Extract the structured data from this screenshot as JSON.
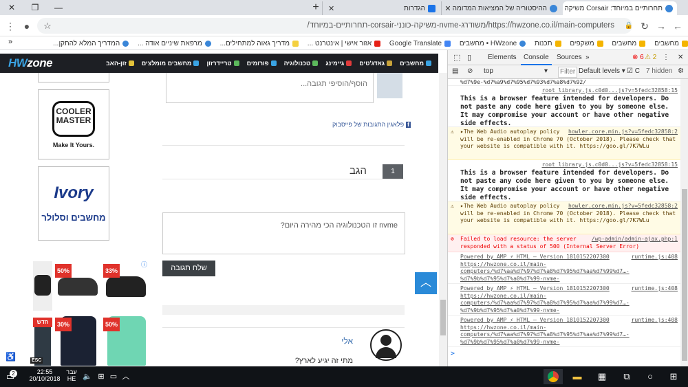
{
  "window": {
    "tabs": [
      {
        "title": "תחרותיים במיוחד: Corsair משיקה ...",
        "active": true
      },
      {
        "title": "ההיסטוריה של המציאות המדומה",
        "active": false
      },
      {
        "title": "הגדרות",
        "active": false
      }
    ],
    "new_tab": "+",
    "controls": {
      "minimize": "—",
      "maximize": "❐",
      "close": "✕"
    }
  },
  "omnibox": {
    "url": "https://hwzone.co.il/main-computers/משודרג-nvme-משיקה-כונני-corsair-תחרותיים-במיוחד/"
  },
  "bookmarks": [
    "מחשבים",
    "מחשבים",
    "משקפים",
    "תכנות",
    "HWzone • מחשבים",
    "Google Translate",
    "אזור אישי | אינטרנט ...",
    "מדריך גאוה למתחילים...",
    "מרפאת שיניים אודה ...",
    "המדריך המלא להתקן..."
  ],
  "site": {
    "logo_main": "HW",
    "logo_sub": "zone",
    "nav": [
      "מחשבים",
      "גאדג'טים",
      "גיימינג",
      "טכנולוגיה",
      "פורומים",
      "טריידרזון",
      "מחשבים מומלצים",
      "זון-האב"
    ]
  },
  "ads": {
    "cooler": {
      "line1": "COOLER",
      "line2": "MASTER",
      "tagline": "Make It Yours."
    },
    "ivory": {
      "brand": "Ivory",
      "sub": "מחשבים וסלולר"
    },
    "badges": [
      "50%",
      "33%",
      "30%",
      "50%",
      "חדש"
    ]
  },
  "comments": {
    "placeholder": "הוסף/הוסיפי תגובה...",
    "fb_plugin": "פלאגין התגובות של פייסבוק"
  },
  "poll": {
    "number": "1",
    "title": "הגב",
    "question_placeholder": "nvme זו הטכנולוגיה הכי מהירה היום?",
    "submit_label": "שלח תגובה"
  },
  "reply": {
    "name": "אלי",
    "text": "מתי זה יגיע לארץ?"
  },
  "devtools": {
    "tabs": [
      "Elements",
      "Console",
      "Sources"
    ],
    "more": "»",
    "errors": "6",
    "warnings": "2",
    "context": "top",
    "filter_placeholder": "Filter",
    "levels": "Default levels ▾",
    "hidden": "7 hidden",
    "messages": [
      {
        "type": "log",
        "src": "",
        "text": "%d7%9e-%d7%a9%d7%95%d7%93%d7%a8%d7%92/"
      },
      {
        "type": "log",
        "src": "root_library.js.c0d0...js?v=5fedc32858:15",
        "text": "This is a browser feature intended for developers. Do not paste any code here given to you by someone else. It may compromise your account or have other negative side effects.",
        "big": true
      },
      {
        "type": "warn",
        "src": "howler.core.min.js?v=5fedc32858:2",
        "text": "▸The Web Audio autoplay policy will be re-enabled in Chrome 70 (October 2018). Please check that your website is compatible with it. https://goo.gl/7K7WLu"
      },
      {
        "type": "log",
        "src": "root_library.js.c0d0...js?v=5fedc32858:15",
        "text": "This is a browser feature intended for developers. Do not paste any code here given to you by someone else. It may compromise your account or have other negative side effects.",
        "big": true
      },
      {
        "type": "warn",
        "src": "howler.core.min.js?v=5fedc32858:2",
        "text": "▸The Web Audio autoplay policy will be re-enabled in Chrome 70 (October 2018). Please check that your website is compatible with it. https://goo.gl/7K7WLu"
      },
      {
        "type": "err",
        "src": "/wp-admin/admin-ajax.php:1",
        "text": "Failed to load resource: the server responded with a status of 500 (Internal Server Error)"
      },
      {
        "type": "log",
        "src": "runtime.js:408",
        "text": "Powered by AMP ⚡ HTML – Version 1810152207300 https://hwzone.co.il/main-computers/%d7%aa%d7%97%d7%a8%d7%95%d7%aa%d7%99%d7…-%d7%9b%d7%95%d7%a0%d7%99-nvme-%d7%9e%d7%a9%d7%95%d7%93%d7%a8%d7%92/"
      },
      {
        "type": "log",
        "src": "runtime.js:408",
        "text": "Powered by AMP ⚡ HTML – Version 1810152207300 https://hwzone.co.il/main-computers/%d7%aa%d7%97%d7%a8%d7%95%d7%aa%d7%99%d7…-%d7%9b%d7%95%d7%a0%d7%99-nvme-%d7%9e%d7%a9%d7%95%d7%93%d7%a8%d7%92/"
      },
      {
        "type": "log",
        "src": "runtime.js:408",
        "text": "Powered by AMP ⚡ HTML – Version 1810152207300 https://hwzone.co.il/main-computers/%d7%aa%d7%97%d7%a8%d7%95%d7%aa%d7%99%d7…-%d7%9b%d7%95%d7%a0%d7%99-nvme-%d7%9e%d7%a9%d7%95%d7%93%d7%a8%d7%92/"
      }
    ],
    "prompt": ">"
  },
  "taskbar": {
    "time": "22:55",
    "date": "20/10/2018",
    "lang_top": "עבר",
    "lang_bottom": "HE",
    "badge": "2"
  }
}
